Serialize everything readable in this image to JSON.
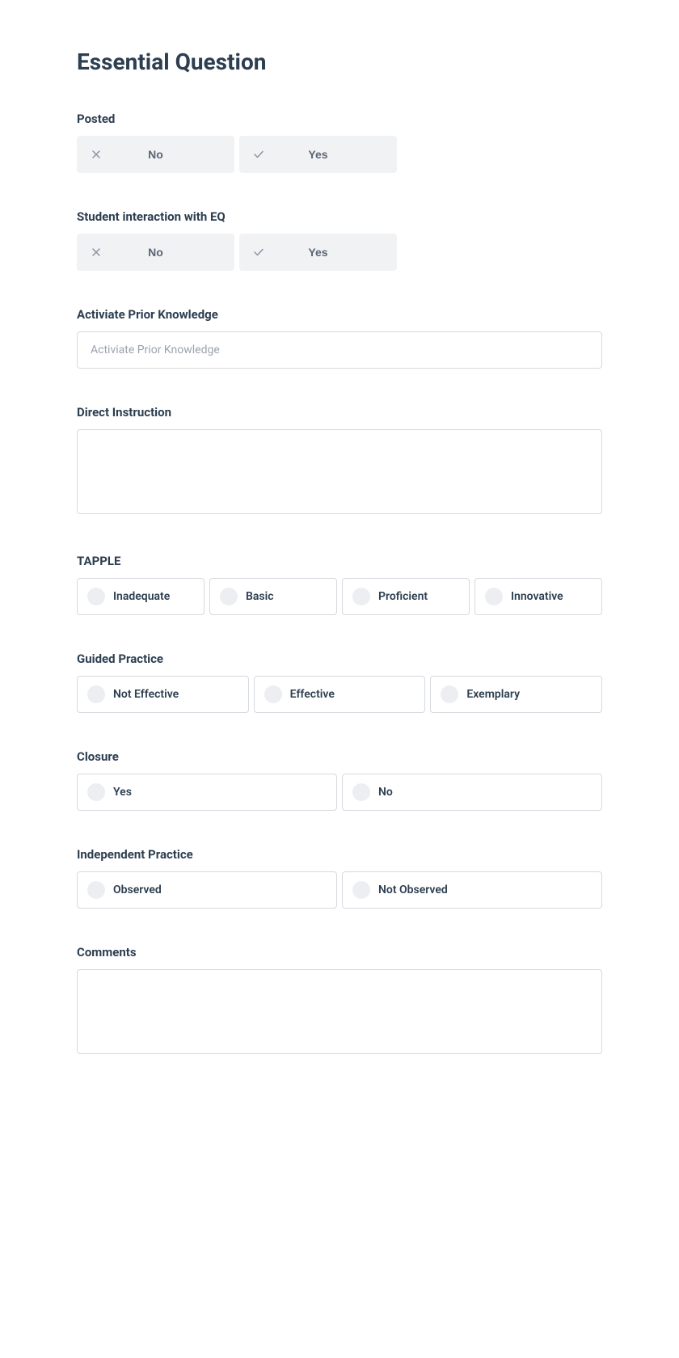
{
  "title": "Essential Question",
  "posted": {
    "label": "Posted",
    "no": "No",
    "yes": "Yes"
  },
  "student_interaction": {
    "label": "Student interaction with EQ",
    "no": "No",
    "yes": "Yes"
  },
  "activate_prior": {
    "label": "Activiate Prior Knowledge",
    "placeholder": "Activiate Prior Knowledge"
  },
  "direct_instruction": {
    "label": "Direct Instruction"
  },
  "tapple": {
    "label": "TAPPLE",
    "options": [
      "Inadequate",
      "Basic",
      "Proficient",
      "Innovative"
    ]
  },
  "guided_practice": {
    "label": "Guided Practice",
    "options": [
      "Not Effective",
      "Effective",
      "Exemplary"
    ]
  },
  "closure": {
    "label": "Closure",
    "options": [
      "Yes",
      "No"
    ]
  },
  "independent_practice": {
    "label": "Independent Practice",
    "options": [
      "Observed",
      "Not Observed"
    ]
  },
  "comments": {
    "label": "Comments"
  }
}
